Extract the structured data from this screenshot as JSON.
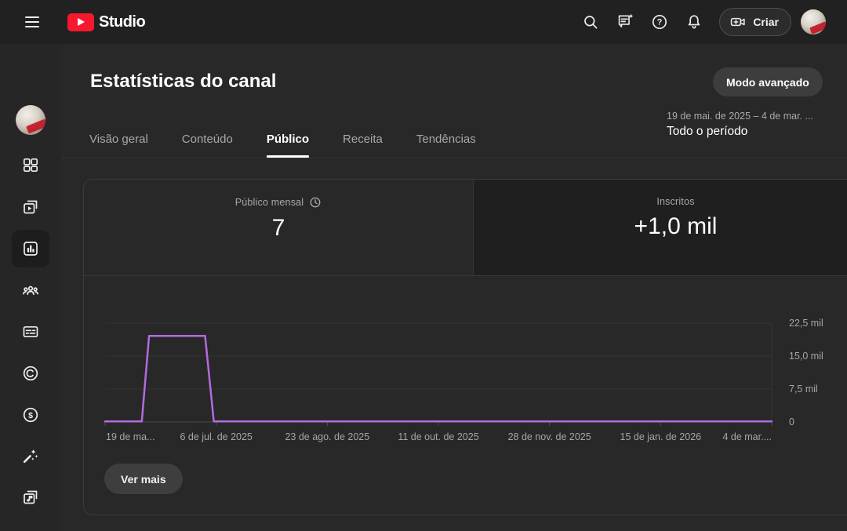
{
  "topbar": {
    "logo_text": "Studio",
    "create_label": "Criar",
    "icons": [
      "menu-icon",
      "search-icon",
      "feedback-icon",
      "help-icon",
      "notifications-icon",
      "create-video-icon",
      "account-avatar"
    ]
  },
  "sidebar": {
    "items": [
      {
        "name": "channel-avatar",
        "selected": false
      },
      {
        "name": "dashboard-icon",
        "selected": false
      },
      {
        "name": "content-icon",
        "selected": false
      },
      {
        "name": "analytics-icon",
        "selected": true
      },
      {
        "name": "community-icon",
        "selected": false
      },
      {
        "name": "subtitles-icon",
        "selected": false
      },
      {
        "name": "copyright-icon",
        "selected": false
      },
      {
        "name": "monetization-icon",
        "selected": false
      },
      {
        "name": "customization-icon",
        "selected": false
      },
      {
        "name": "audio-library-icon",
        "selected": false
      }
    ]
  },
  "page": {
    "title": "Estatísticas do canal",
    "advanced_mode_label": "Modo avançado",
    "date_range": "19 de mai. de 2025 – 4 de mar. ...",
    "period_label": "Todo o período",
    "tabs": [
      {
        "label": "Visão geral",
        "active": false
      },
      {
        "label": "Conteúdo",
        "active": false
      },
      {
        "label": "Público",
        "active": true
      },
      {
        "label": "Receita",
        "active": false
      },
      {
        "label": "Tendências",
        "active": false
      }
    ],
    "metric_cards": [
      {
        "label": "Público mensal",
        "value": "7",
        "icon": "clock-icon",
        "selected": false
      },
      {
        "label": "Inscritos",
        "value": "+1,0 mil",
        "icon": null,
        "selected": true
      }
    ],
    "see_more_label": "Ver mais"
  },
  "colors": {
    "brand_red": "#f6192e",
    "chart_line": "#b36be0"
  },
  "chart_data": {
    "type": "line",
    "title": "",
    "x_range": [
      "19 de mai. de 2025",
      "4 de mar. de 2026"
    ],
    "x_ticks": [
      "19 de ma...",
      "6 de jul. de 2025",
      "23 de ago. de 2025",
      "11 de out. de 2025",
      "28 de nov. de 2025",
      "15 de jan. de 2026",
      "4 de mar...."
    ],
    "y_ticks": [
      {
        "label": "22,5 mil",
        "value": 22500
      },
      {
        "label": "15,0 mil",
        "value": 15000
      },
      {
        "label": "7,5 mil",
        "value": 7500
      },
      {
        "label": "0",
        "value": 0
      }
    ],
    "ylim": [
      0,
      24100
    ],
    "grid": true,
    "legend": "none",
    "series": [
      {
        "name": "Inscritos",
        "color": "#b36be0",
        "points": [
          {
            "t": 0.0,
            "v": 120
          },
          {
            "t": 0.055,
            "v": 120
          },
          {
            "t": 0.066,
            "v": 19600
          },
          {
            "t": 0.15,
            "v": 19600
          },
          {
            "t": 0.163,
            "v": 120
          },
          {
            "t": 1.0,
            "v": 120
          }
        ]
      }
    ]
  }
}
